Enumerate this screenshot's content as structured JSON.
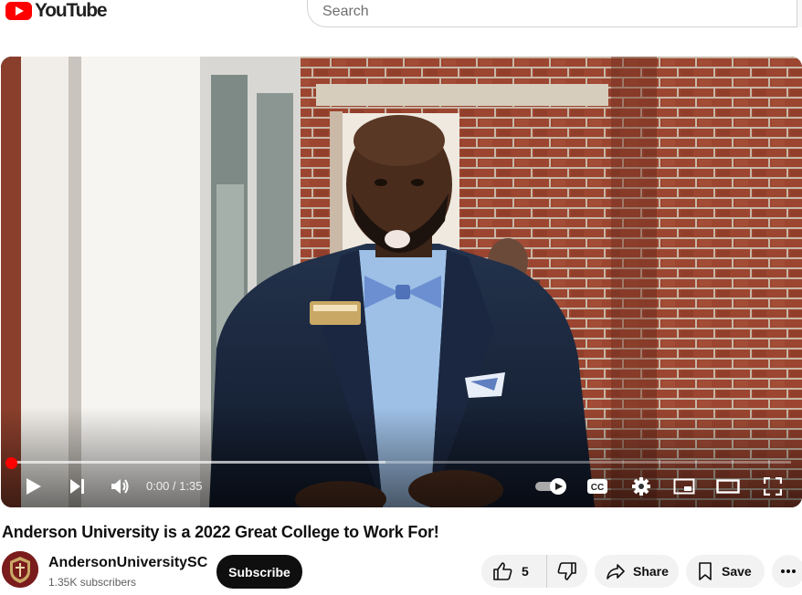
{
  "header": {
    "logo_text": "YouTube",
    "search_placeholder": "Search"
  },
  "player": {
    "time_display": "0:00 / 1:35",
    "progress_fraction": 0.0,
    "buffered_fraction": 0.48,
    "controls": [
      "play-icon",
      "next-icon",
      "volume-icon",
      "autoplay-toggle",
      "captions-icon",
      "settings-icon",
      "miniplayer-icon",
      "theater-icon",
      "fullscreen-icon"
    ],
    "accent_color": "#ff0000"
  },
  "video": {
    "title": "Anderson University is a 2022 Great College to Work For!"
  },
  "channel": {
    "name": "AndersonUniversitySC",
    "subscribers": "1.35K subscribers",
    "subscribe_label": "Subscribe"
  },
  "actions": {
    "like_count": "5",
    "share_label": "Share",
    "save_label": "Save"
  }
}
